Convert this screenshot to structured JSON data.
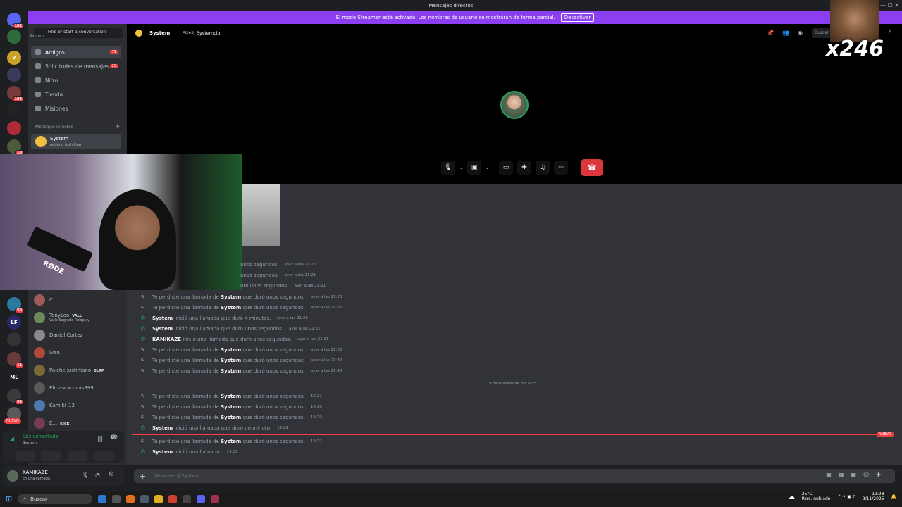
{
  "window": {
    "title": "Mensajes directos"
  },
  "banner": {
    "text": "El modo Streamer está activado. Los nombres de usuario se mostrarán de forma parcial.",
    "button": "Desactivar"
  },
  "rail": {
    "servers": [
      {
        "label": "",
        "badge": "102",
        "color": "#5865f2"
      },
      {
        "label": "",
        "badge": "",
        "color": "#2f6b3a"
      },
      {
        "label": "V",
        "badge": "",
        "color": "#c9a227"
      },
      {
        "label": "",
        "badge": "",
        "color": "#3a3a5a"
      },
      {
        "label": "",
        "badge": "108",
        "color": "#7a3a3a"
      },
      {
        "label": "",
        "badge": "",
        "color": "#222"
      },
      {
        "label": "",
        "badge": "",
        "color": "#b02a3a"
      },
      {
        "label": "",
        "badge": "10",
        "color": "#4a5a3a"
      },
      {
        "label": "",
        "badge": "50",
        "color": "#2a7aa0"
      },
      {
        "label": "LF",
        "badge": "",
        "color": "#2a2a6a"
      },
      {
        "label": "",
        "badge": "",
        "color": "#333"
      },
      {
        "label": "",
        "badge": "11",
        "color": "#6a3a3a"
      },
      {
        "label": "ML",
        "badge": "",
        "color": "#1e1f22"
      },
      {
        "label": "",
        "badge": "93",
        "color": "#3a3a3a"
      },
      {
        "label": "",
        "badge": "",
        "color": "#5a5a5a"
      }
    ],
    "nuevo": "NUEVO"
  },
  "sidebar": {
    "search_placeholder": "Find or start a conversation",
    "tooltip": "System",
    "nav": [
      {
        "label": "Amigos",
        "badge": "79"
      },
      {
        "label": "Solicitudes de mensajes",
        "badge": "23"
      },
      {
        "label": "Nitro",
        "badge": ""
      },
      {
        "label": "Tienda",
        "badge": ""
      },
      {
        "label": "Misiones",
        "badge": ""
      }
    ],
    "dm_header": "Mensajes directos",
    "dm_plus": "+",
    "selected_dm": {
      "name": "System",
      "status": "nothing is chilling"
    },
    "dms": [
      {
        "name": "C...",
        "tag": "",
        "color": "#a05a5a"
      },
      {
        "name": "TonyLoo",
        "tag": "VALL",
        "sub": "Valle Sagrado Roleplay -",
        "color": "#6a8a5a"
      },
      {
        "name": "Daniel Cortez",
        "tag": "",
        "color": "#8a8a8a"
      },
      {
        "name": "ivan",
        "tag": "",
        "color": "#b04a3a"
      },
      {
        "name": "Paiche justiniano",
        "tag": "BLRP",
        "color": "#7a6a3a"
      },
      {
        "name": "Elmascacucas999",
        "tag": "",
        "color": "#5a5a5a"
      },
      {
        "name": "Kamiki_13",
        "tag": "",
        "color": "#4a7ab0"
      },
      {
        "name": "E...",
        "tag": "KICK",
        "color": "#7a3a5a"
      }
    ]
  },
  "voice": {
    "status": "Voz conectada",
    "channel": "System"
  },
  "user": {
    "name": "KAMIKAZE",
    "status": "En una llamada"
  },
  "topbar": {
    "name": "System",
    "alias_label": "ALIAS",
    "alias": "Systemcio",
    "search": "Buscar"
  },
  "overlay": {
    "counter": "x246",
    "cam_label": "RØDE"
  },
  "chat": {
    "partial": [
      {
        "text": "unos segundos.",
        "ts": "ayer a las 21:20"
      },
      {
        "text": "unos segundos.",
        "ts": "ayer a las 21:21"
      },
      {
        "text": "uró unos segundos.",
        "ts": "ayer a las 21:21"
      }
    ],
    "messages": [
      {
        "type": "miss",
        "pre": "Te perdiste una llamada de",
        "user": "System",
        "post": "que duró unos segundos.",
        "ts": "ayer a las 21:23"
      },
      {
        "type": "miss",
        "pre": "Te perdiste una llamada de",
        "user": "System",
        "post": "que duró unos segundos.",
        "ts": "ayer a las 21:25"
      },
      {
        "type": "start",
        "pre": "",
        "user": "System",
        "post": "inició una llamada que duró 4 minutos.",
        "ts": "ayer a las 21:26"
      },
      {
        "type": "start",
        "pre": "",
        "user": "System",
        "post": "inició una llamada que duró unos segundos.",
        "ts": "ayer a las 21:31"
      },
      {
        "type": "start",
        "pre": "",
        "user": "KAMIKAZE",
        "post": "inició una llamada que duró unos segundos.",
        "ts": "ayer a las 21:31"
      },
      {
        "type": "miss",
        "pre": "Te perdiste una llamada de",
        "user": "System",
        "post": "que duró unos segundos.",
        "ts": "ayer a las 21:36"
      },
      {
        "type": "miss",
        "pre": "Te perdiste una llamada de",
        "user": "System",
        "post": "que duró unos segundos.",
        "ts": "ayer a las 21:37"
      },
      {
        "type": "miss",
        "pre": "Te perdiste una llamada de",
        "user": "System",
        "post": "que duró unos segundos.",
        "ts": "ayer a las 21:43"
      }
    ],
    "date_sep": "9 de noviembre de 2025",
    "messages2": [
      {
        "type": "miss",
        "pre": "Te perdiste una llamada de",
        "user": "System",
        "post": "que duró unos segundos.",
        "ts": "19:22"
      },
      {
        "type": "miss",
        "pre": "Te perdiste una llamada de",
        "user": "System",
        "post": "que duró unos segundos.",
        "ts": "19:26"
      },
      {
        "type": "miss",
        "pre": "Te perdiste una llamada de",
        "user": "System",
        "post": "que duró unos segundos.",
        "ts": "19:29"
      },
      {
        "type": "start",
        "pre": "",
        "user": "System",
        "post": "inició una llamada que duró un minuto.",
        "ts": "19:29"
      }
    ],
    "new_tag": "NUEVO",
    "messages3": [
      {
        "type": "miss",
        "pre": "Te perdiste una llamada de",
        "user": "System",
        "post": "que duró unos segundos.",
        "ts": "19:32"
      },
      {
        "type": "start",
        "pre": "",
        "user": "System",
        "post": "inició una llamada.",
        "ts": "19:32"
      }
    ],
    "composer_placeholder": "Mensaje @System"
  },
  "taskbar": {
    "search": "Buscar",
    "weather": "25°C",
    "weather_desc": "Parc. nublado",
    "time": "19:28",
    "date": "9/11/2025"
  }
}
